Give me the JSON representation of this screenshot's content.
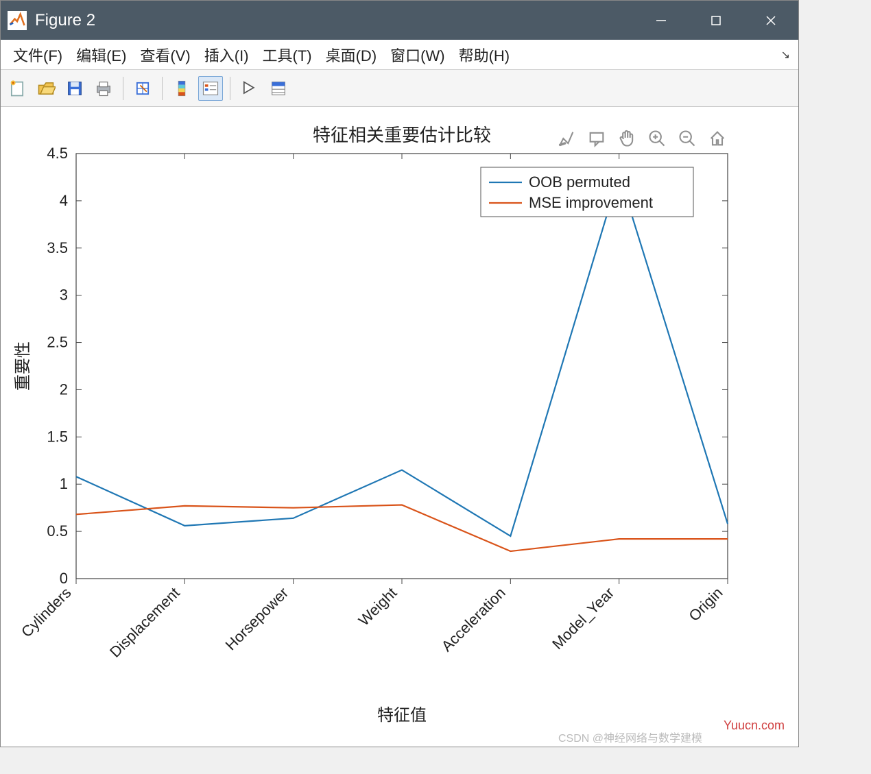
{
  "window": {
    "title": "Figure 2"
  },
  "menu": {
    "file": "文件(F)",
    "edit": "编辑(E)",
    "view": "查看(V)",
    "insert": "插入(I)",
    "tools": "工具(T)",
    "desktop": "桌面(D)",
    "window": "窗口(W)",
    "help": "帮助(H)"
  },
  "legend": {
    "s1": "OOB permuted",
    "s2": "MSE improvement"
  },
  "watermarks": {
    "site": "Yuucn.com",
    "csdn": "CSDN @神经网络与数学建模"
  },
  "chart_data": {
    "type": "line",
    "title": "特征相关重要估计比较",
    "xlabel": "特征值",
    "ylabel": "重要性",
    "ylim": [
      0,
      4.5
    ],
    "yticks": [
      0,
      0.5,
      1,
      1.5,
      2,
      2.5,
      3,
      3.5,
      4,
      4.5
    ],
    "categories": [
      "Cylinders",
      "Displacement",
      "Horsepower",
      "Weight",
      "Acceleration",
      "Model_Year",
      "Origin"
    ],
    "series": [
      {
        "name": "OOB permuted",
        "color": "#1f77b4",
        "values": [
          1.08,
          0.56,
          0.64,
          1.15,
          0.45,
          4.28,
          0.58
        ]
      },
      {
        "name": "MSE improvement",
        "color": "#d95319",
        "values": [
          0.68,
          0.77,
          0.75,
          0.78,
          0.29,
          0.42,
          0.42
        ]
      }
    ]
  }
}
